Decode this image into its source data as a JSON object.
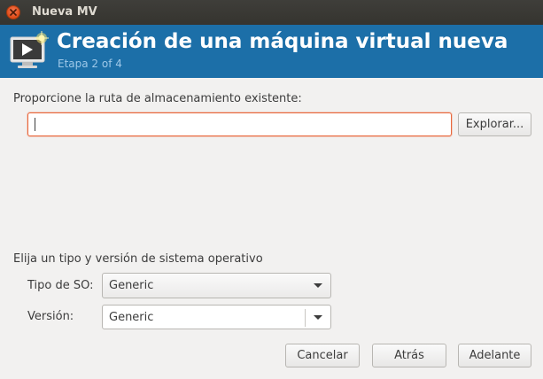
{
  "window": {
    "title": "Nueva MV"
  },
  "banner": {
    "title": "Creación de una máquina virtual nueva",
    "subtitle": "Etapa 2 of 4"
  },
  "storage": {
    "label": "Proporcione la ruta de almacenamiento existente:",
    "path_value": "",
    "browse_label": "Explorar..."
  },
  "os": {
    "label": "Elija un tipo y versión de sistema operativo",
    "type_label": "Tipo de SO:",
    "type_value": "Generic",
    "version_label": "Versión:",
    "version_value": "Generic"
  },
  "buttons": {
    "cancel": "Cancelar",
    "back": "Atrás",
    "forward": "Adelante"
  },
  "colors": {
    "banner": "#1c6fa8",
    "titlebar": "#3c3b37",
    "input_focus_border": "#e9663a"
  },
  "icons": {
    "close": "close-icon",
    "vm": "virtual-machine-icon",
    "dropdown": "chevron-down-icon"
  }
}
